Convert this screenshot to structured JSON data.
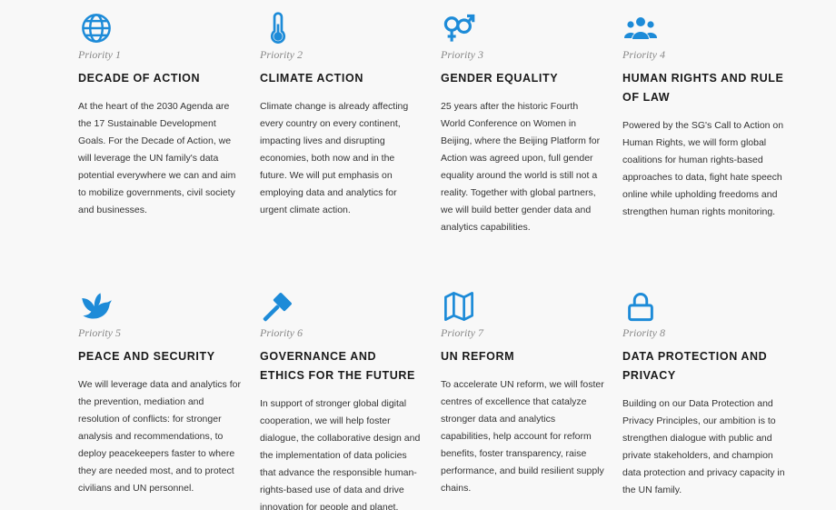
{
  "priorities": [
    {
      "icon": "globe-icon",
      "label": "Priority 1",
      "title": "DECADE OF ACTION",
      "text": "At the heart of the 2030 Agenda are the 17 Sustainable Development Goals. For the Decade of Action, we will leverage the UN family's data potential everywhere we can and aim to mobilize governments, civil society and businesses."
    },
    {
      "icon": "thermometer-icon",
      "label": "Priority 2",
      "title": "CLIMATE ACTION",
      "text": "Climate change is already affecting every country on every continent, impacting lives and disrupting economies, both now and in the future. We will put emphasis on employing data and analytics for urgent climate action."
    },
    {
      "icon": "gender-icon",
      "label": "Priority 3",
      "title": "GENDER EQUALITY",
      "text": "25 years after the historic Fourth World Conference on Women in Beijing, where the Beijing Platform for Action was agreed upon, full gender equality around the world is still not a reality. Together with global partners, we will build better gender data and analytics capabilities."
    },
    {
      "icon": "people-group-icon",
      "label": "Priority 4",
      "title": "HUMAN RIGHTS AND RULE OF LAW",
      "text": "Powered by the SG's Call to Action on Human Rights, we will form global coalitions for human rights-based approaches to data, fight hate speech online while upholding freedoms and strengthen human rights monitoring."
    },
    {
      "icon": "dove-icon",
      "label": "Priority 5",
      "title": "PEACE AND SECURITY",
      "text": "We will leverage data and analytics for the prevention, mediation and resolution of conflicts: for stronger analysis and recommendations, to deploy peacekeepers faster to where they are needed most, and to protect civilians and UN personnel."
    },
    {
      "icon": "gavel-icon",
      "label": "Priority 6",
      "title": "GOVERNANCE AND ETHICS FOR THE FUTURE",
      "text": "In support of stronger global digital cooperation, we will help foster dialogue, the collaborative design and the implementation of data policies that advance the responsible human-rights-based use of data and drive innovation for people and planet."
    },
    {
      "icon": "map-icon",
      "label": "Priority 7",
      "title": "UN REFORM",
      "text": "To accelerate UN reform, we will foster centres of excellence that catalyze stronger data and analytics capabilities, help account for reform benefits, foster transparency, raise performance, and build resilient supply chains."
    },
    {
      "icon": "lock-icon",
      "label": "Priority 8",
      "title": "DATA PROTECTION AND PRIVACY",
      "text": "Building on our Data Protection and Privacy Principles, our ambition is to strengthen dialogue with public and private stakeholders, and champion data protection and privacy capacity in the UN family."
    }
  ],
  "colors": {
    "accent": "#1d8bd8",
    "background": "#f8f8f8"
  }
}
